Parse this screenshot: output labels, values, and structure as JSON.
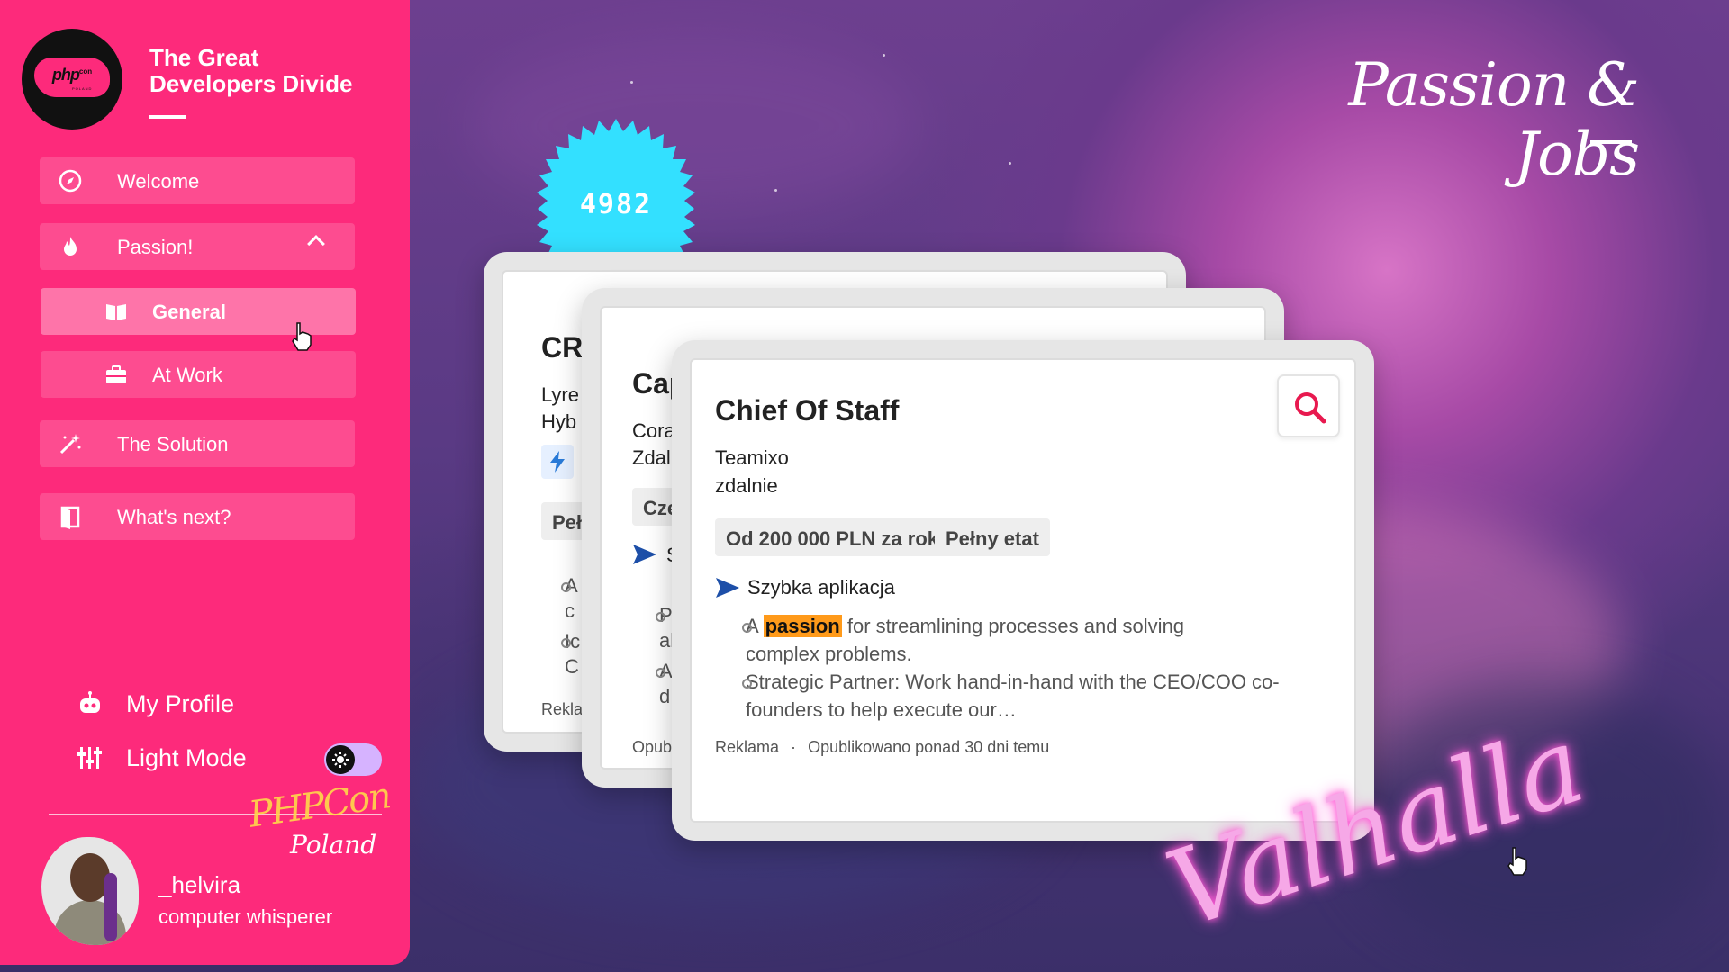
{
  "sidebar": {
    "title": "The Great Developers Divide",
    "logo_text": "php",
    "logo_sup": "con",
    "logo_sub": "POLAND",
    "nav": {
      "welcome": "Welcome",
      "passion": "Passion!",
      "general": "General",
      "at_work": "At Work",
      "solution": "The Solution",
      "whats_next": "What's next?"
    },
    "my_profile": "My Profile",
    "light_mode": "Light Mode",
    "phpcon_script": "PHPCon",
    "poland_script": "Poland",
    "user": {
      "name": "_helvira",
      "role": "computer whisperer"
    }
  },
  "header": {
    "title": "Passion & Jobs"
  },
  "badge": {
    "count": "4982"
  },
  "cards": {
    "back": {
      "title": "CR",
      "company": "Lyre",
      "mode": "Hyb",
      "chip": "Peł",
      "bullets": [
        "A",
        "c",
        "Ic",
        "C"
      ],
      "footer": "Rekla"
    },
    "middle": {
      "title": "Cap",
      "company": "Cora",
      "mode": "Zdal",
      "chip": "Czę",
      "apply": "S",
      "bullets": [
        "P",
        "al",
        "A",
        "d"
      ],
      "footer": "Opub"
    },
    "front": {
      "title": "Chief Of Staff",
      "company": "Teamixo",
      "mode": "zdalnie",
      "salary_chip": "Od 200 000 PLN za rok",
      "type_chip": "Pełny etat",
      "apply": "Szybka aplikacja",
      "bullet1_pre": "A",
      "bullet1_hl": "passion",
      "bullet1_post": "for streamlining processes and solving complex problems.",
      "bullet2": "Strategic Partner: Work hand-in-hand with the CEO/COO co-founders to help execute our…",
      "footer_ad": "Reklama",
      "footer_dot": "·",
      "footer_published": "Opublikowano ponad 30 dni temu"
    }
  },
  "neon": "Valhalla",
  "colors": {
    "sidebar": "#fd2a7b",
    "badge": "#33e0ff",
    "highlight": "#ff9a1a",
    "search": "#e8194f",
    "apply_arrow": "#1d4fa8"
  }
}
